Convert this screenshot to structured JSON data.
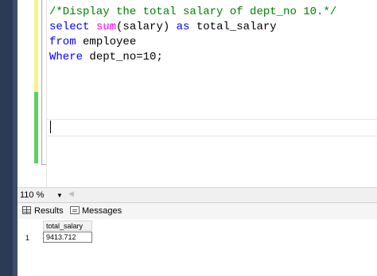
{
  "editor": {
    "lines": [
      [
        {
          "cls": "cmt",
          "text": "/*Display the total salary of dept_no 10.*/"
        }
      ],
      [
        {
          "cls": "kw",
          "text": "select "
        },
        {
          "cls": "fn",
          "text": "sum"
        },
        {
          "cls": "",
          "text": "(salary) "
        },
        {
          "cls": "kw",
          "text": "as"
        },
        {
          "cls": "",
          "text": " total_salary"
        }
      ],
      [
        {
          "cls": "kw",
          "text": "from"
        },
        {
          "cls": "",
          "text": " employee"
        }
      ],
      [
        {
          "cls": "kw",
          "text": "Where"
        },
        {
          "cls": "",
          "text": " dept_no"
        },
        {
          "cls": "",
          "text": "="
        },
        {
          "cls": "",
          "text": "10;"
        }
      ]
    ]
  },
  "zoom": {
    "value": "110 %"
  },
  "results_tabs": {
    "results_label": "Results",
    "messages_label": "Messages"
  },
  "results_grid": {
    "column_header": "total_salary",
    "row_number": "1",
    "cell_value": "9413.712"
  },
  "colors": {
    "comment": "#008000",
    "keyword": "#0000ff",
    "function": "#ff00ff",
    "change_saved": "#5bd25b",
    "change_unsaved": "#f8f28a"
  },
  "icons": {
    "results_tab": "grid-icon",
    "messages_tab": "messages-icon"
  }
}
